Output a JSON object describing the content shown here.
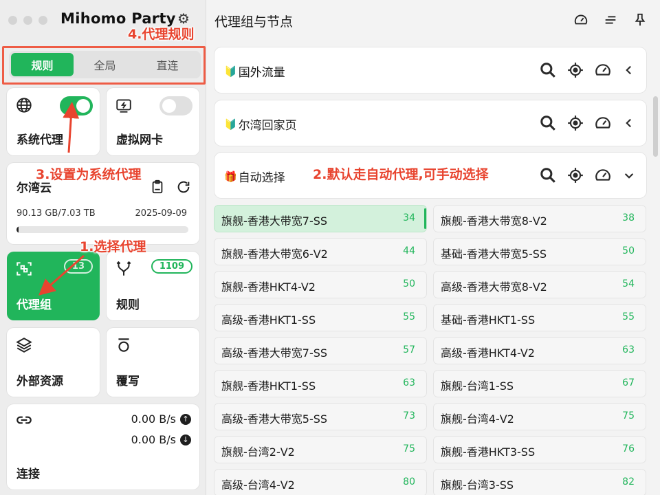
{
  "app": {
    "title": "Mihomo Party"
  },
  "mode_tabs": [
    {
      "label": "规则",
      "active": true
    },
    {
      "label": "全局",
      "active": false
    },
    {
      "label": "直连",
      "active": false
    }
  ],
  "cards": {
    "system_proxy": {
      "label": "系统代理",
      "icon": "globe-icon",
      "enabled": true
    },
    "virtual_nic": {
      "label": "虚拟网卡",
      "icon": "network-card-icon",
      "enabled": false
    },
    "subscription": {
      "name": "尔湾云",
      "usage": "90.13 GB/7.03 TB",
      "expire": "2025-09-09",
      "progress": 0.013
    },
    "proxy_groups": {
      "label": "代理组",
      "badge": "13",
      "icon": "scan-icon"
    },
    "rules": {
      "label": "规则",
      "badge": "1109",
      "icon": "fork-icon"
    },
    "external_resources": {
      "label": "外部资源",
      "icon": "layers-icon"
    },
    "override": {
      "label": "覆写",
      "icon": "override-icon"
    },
    "connections": {
      "label": "连接",
      "upload": "0.00 B/s",
      "download": "0.00 B/s",
      "icon": "link-icon"
    }
  },
  "main": {
    "title": "代理组与节点",
    "groups": [
      {
        "flag": "🔰",
        "name": "国外流量",
        "expanded": false
      },
      {
        "flag": "🔰",
        "name": "尔湾回家页",
        "expanded": false
      },
      {
        "flag": "🎁",
        "name": "自动选择",
        "expanded": true
      }
    ],
    "proxies": [
      {
        "name": "旗舰-香港大带宽7-SS",
        "delay": "34"
      },
      {
        "name": "旗舰-香港大带宽8-V2",
        "delay": "38"
      },
      {
        "name": "旗舰-香港大带宽6-V2",
        "delay": "44"
      },
      {
        "name": "基础-香港大带宽5-SS",
        "delay": "50"
      },
      {
        "name": "旗舰-香港HKT4-V2",
        "delay": "50"
      },
      {
        "name": "高级-香港大带宽8-V2",
        "delay": "54"
      },
      {
        "name": "高级-香港HKT1-SS",
        "delay": "55"
      },
      {
        "name": "基础-香港HKT1-SS",
        "delay": "55"
      },
      {
        "name": "高级-香港大带宽7-SS",
        "delay": "57"
      },
      {
        "name": "高级-香港HKT4-V2",
        "delay": "63"
      },
      {
        "name": "旗舰-香港HKT1-SS",
        "delay": "63"
      },
      {
        "name": "旗舰-台湾1-SS",
        "delay": "67"
      },
      {
        "name": "高级-香港大带宽5-SS",
        "delay": "73"
      },
      {
        "name": "旗舰-台湾4-V2",
        "delay": "75"
      },
      {
        "name": "旗舰-台湾2-V2",
        "delay": "75"
      },
      {
        "name": "旗舰-香港HKT3-SS",
        "delay": "76"
      },
      {
        "name": "高级-台湾4-V2",
        "delay": "80"
      },
      {
        "name": "旗舰-台湾3-SS",
        "delay": "82"
      }
    ]
  },
  "annotations": {
    "a1": "1.选择代理",
    "a2": "2.默认走自动代理,可手动选择",
    "a3": "3.设置为系统代理",
    "a4": "4.代理规则"
  },
  "colors": {
    "accent": "#21b55b",
    "annotation": "#e8442f"
  }
}
